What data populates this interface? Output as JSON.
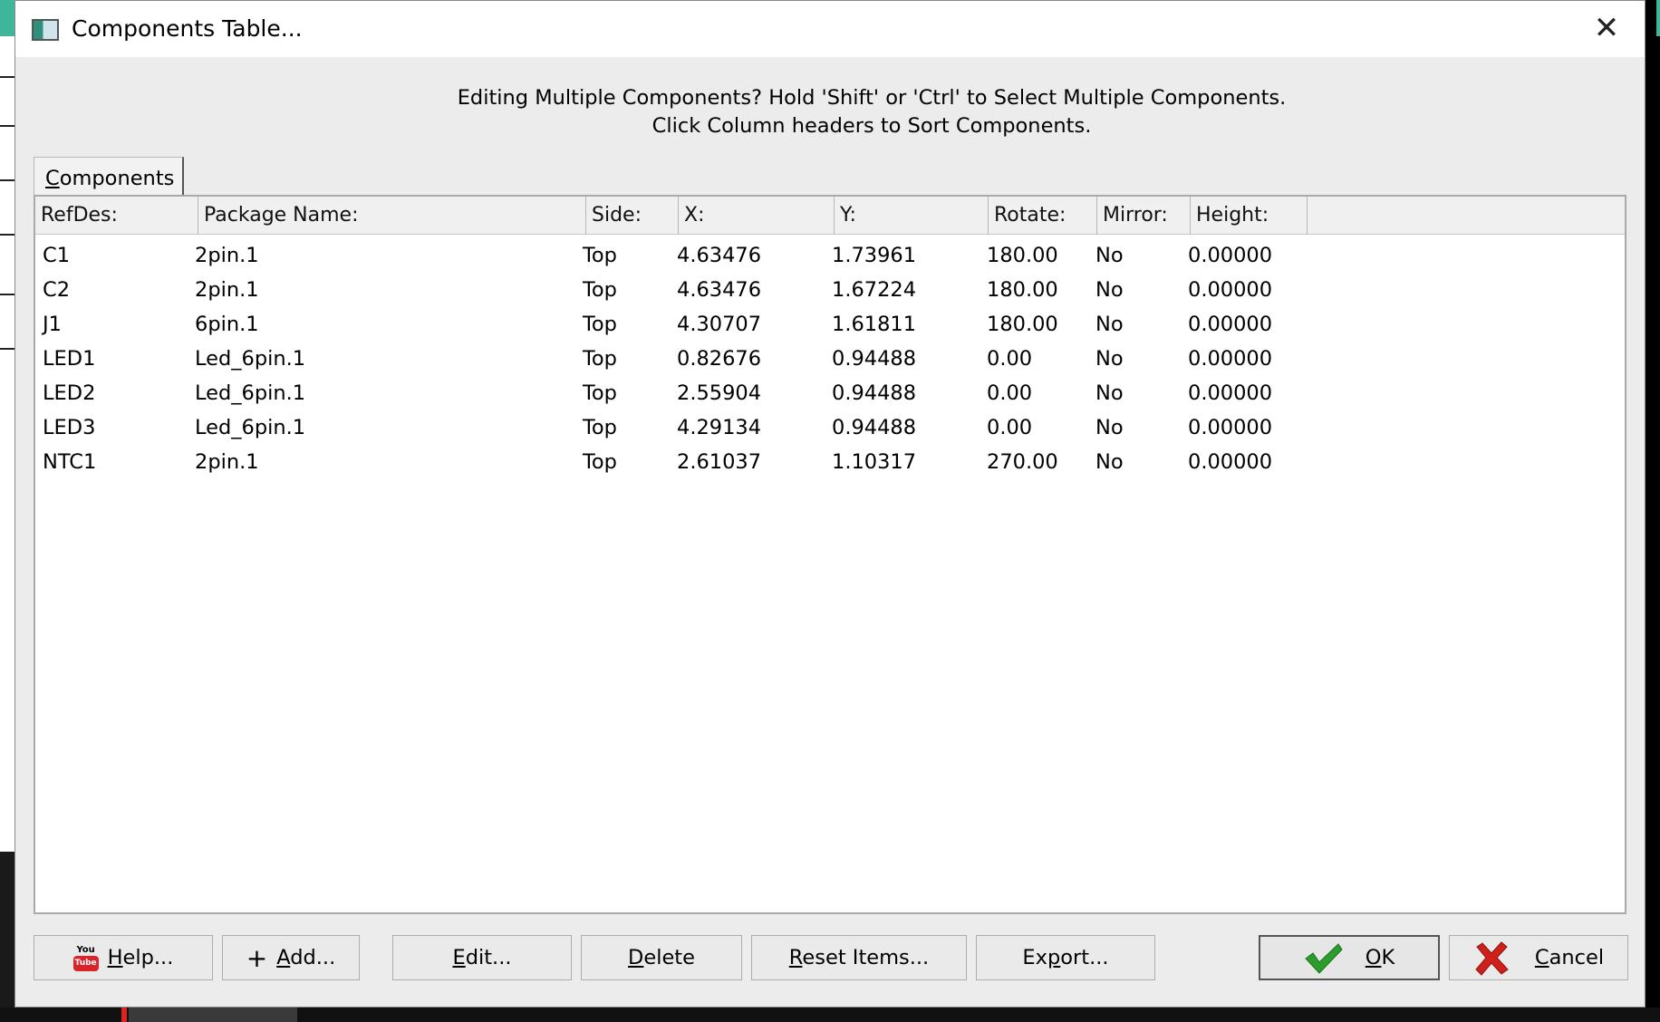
{
  "window": {
    "title": "Components Table...",
    "close_glyph": "✕"
  },
  "info": {
    "line1": "Editing Multiple Components?  Hold 'Shift' or 'Ctrl' to Select Multiple Components.",
    "line2": "Click Column headers to Sort Components."
  },
  "tab": {
    "label_underlined": "C",
    "label_rest": "omponents"
  },
  "table": {
    "headers": [
      "RefDes:",
      "Package Name:",
      "Side:",
      "X:",
      "Y:",
      "Rotate:",
      "Mirror:",
      "Height:"
    ],
    "rows": [
      [
        "C1",
        "2pin.1",
        "Top",
        "4.63476",
        "1.73961",
        "180.00",
        "No",
        "0.00000"
      ],
      [
        "C2",
        "2pin.1",
        "Top",
        "4.63476",
        "1.67224",
        "180.00",
        "No",
        "0.00000"
      ],
      [
        "J1",
        "6pin.1",
        "Top",
        "4.30707",
        "1.61811",
        "180.00",
        "No",
        "0.00000"
      ],
      [
        "LED1",
        "Led_6pin.1",
        "Top",
        "0.82676",
        "0.94488",
        "0.00",
        "No",
        "0.00000"
      ],
      [
        "LED2",
        "Led_6pin.1",
        "Top",
        "2.55904",
        "0.94488",
        "0.00",
        "No",
        "0.00000"
      ],
      [
        "LED3",
        "Led_6pin.1",
        "Top",
        "4.29134",
        "0.94488",
        "0.00",
        "No",
        "0.00000"
      ],
      [
        "NTC1",
        "2pin.1",
        "Top",
        "2.61037",
        "1.10317",
        "270.00",
        "No",
        "0.00000"
      ]
    ]
  },
  "buttons": {
    "help": {
      "u": "H",
      "rest": "elp...",
      "icon": "youtube-icon",
      "icon_top": "You",
      "icon_bottom": "Tube"
    },
    "add": {
      "pre": "+",
      "u": "A",
      "rest": "dd...",
      "icon": "plus-icon"
    },
    "edit": {
      "u": "E",
      "rest": "dit..."
    },
    "delete": {
      "u": "D",
      "rest": "elete"
    },
    "reset": {
      "u": "R",
      "rest": "eset Items..."
    },
    "export": {
      "pre": "Ex",
      "u": "p",
      "rest": "ort..."
    },
    "ok": {
      "u": "O",
      "rest": "K",
      "icon": "checkmark-icon",
      "color": "#2a9d2a"
    },
    "cancel": {
      "u": "C",
      "rest": "ancel",
      "icon": "red-x-icon",
      "color": "#d0201b"
    }
  }
}
